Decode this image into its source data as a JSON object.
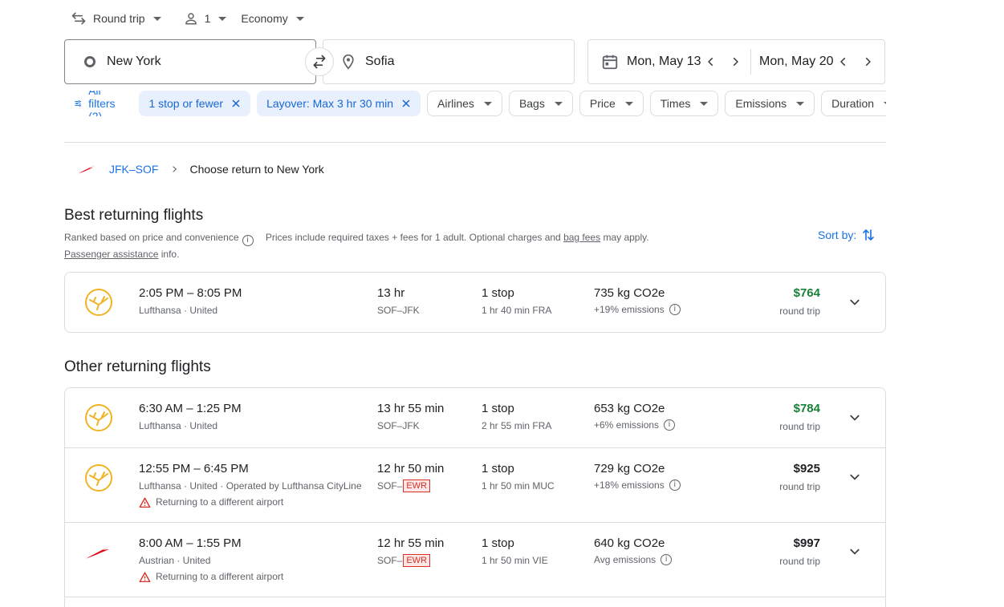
{
  "top": {
    "trip_type": "Round trip",
    "passengers": "1",
    "cabin": "Economy"
  },
  "search": {
    "origin": "New York",
    "destination": "Sofia",
    "depart_date": "Mon, May 13",
    "return_date": "Mon, May 20"
  },
  "filters": {
    "all_filters": "All filters (2)",
    "active": [
      {
        "label": "1 stop or fewer"
      },
      {
        "label": "Layover: Max 3 hr 30 min"
      }
    ],
    "dropdowns": [
      "Airlines",
      "Bags",
      "Price",
      "Times",
      "Emissions",
      "Duration"
    ]
  },
  "breadcrumb": {
    "route": "JFK–SOF",
    "step": "Choose return to New York"
  },
  "best": {
    "title": "Best returning flights",
    "ranked": "Ranked based on price and convenience",
    "prices_note": "Prices include required taxes + fees for 1 adult. Optional charges and ",
    "bag_fees": "bag fees",
    "may_apply": " may apply.",
    "passenger_assistance": "Passenger assistance",
    "info": " info.",
    "sort_by": "Sort by:"
  },
  "other": {
    "title": "Other returning flights"
  },
  "flights_best": [
    {
      "logo": "lufthansa",
      "times": "2:05 PM – 8:05 PM",
      "airline": "Lufthansa · United",
      "duration": "13 hr",
      "airports": "SOF–JFK",
      "stops": "1 stop",
      "layover": "1 hr 40 min FRA",
      "co2": "735 kg CO2e",
      "emissions": "+19% emissions",
      "price": "$764",
      "price_type": "round trip"
    }
  ],
  "flights_other": [
    {
      "logo": "lufthansa",
      "times": "6:30 AM – 1:25 PM",
      "airline": "Lufthansa · United",
      "duration": "13 hr 55 min",
      "airports": "SOF–JFK",
      "stops": "1 stop",
      "layover": "2 hr 55 min FRA",
      "co2": "653 kg CO2e",
      "emissions": "+6% emissions",
      "price": "$784",
      "price_type": "round trip"
    },
    {
      "logo": "lufthansa",
      "times": "12:55 PM – 6:45 PM",
      "airline": "Lufthansa · United · Operated by Lufthansa CityLine",
      "warning": "Returning to a different airport",
      "duration": "12 hr 50 min",
      "airports_from": "SOF–",
      "airports_to": "EWR",
      "stops": "1 stop",
      "layover": "1 hr 50 min MUC",
      "co2": "729 kg CO2e",
      "emissions": "+18% emissions",
      "price": "$925",
      "price_type": "round trip"
    },
    {
      "logo": "austrian",
      "times": "8:00 AM – 1:55 PM",
      "airline": "Austrian · United",
      "warning": "Returning to a different airport",
      "duration": "12 hr 55 min",
      "airports_from": "SOF–",
      "airports_to": "EWR",
      "stops": "1 stop",
      "layover": "1 hr 50 min VIE",
      "co2": "640 kg CO2e",
      "emissions": "Avg emissions",
      "price": "$997",
      "price_type": "round trip"
    }
  ],
  "colors": {
    "accent": "#1a73e8",
    "chip_bg": "#e8f0fe",
    "price_green": "#188038",
    "warning_red": "#d93025",
    "lufthansa_yellow": "#f0b323",
    "austrian_red": "#e30613"
  }
}
